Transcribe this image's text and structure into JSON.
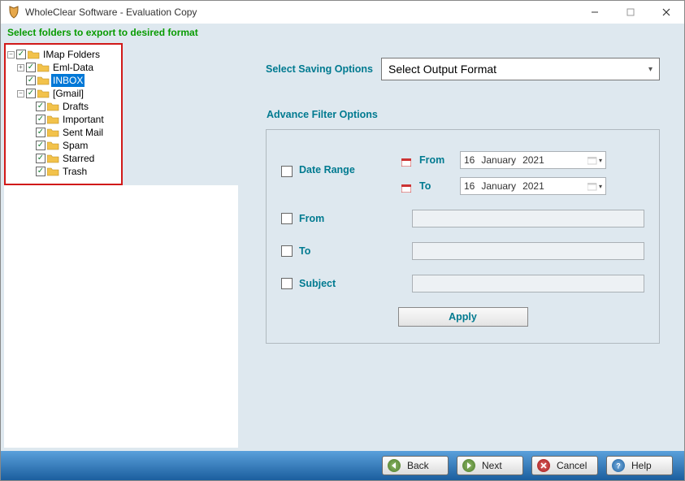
{
  "window": {
    "title": "WholeClear Software - Evaluation Copy"
  },
  "subtitle": "Select folders to export to desired format",
  "tree": {
    "root": "IMap Folders",
    "items": [
      "Eml-Data",
      "INBOX",
      "[Gmail]"
    ],
    "gmail_children": [
      "Drafts",
      "Important",
      "Sent Mail",
      "Spam",
      "Starred",
      "Trash"
    ]
  },
  "saving": {
    "label": "Select Saving Options",
    "placeholder": "Select Output Format"
  },
  "advance": {
    "legend": "Advance Filter Options",
    "date_range": "Date Range",
    "from_date_label": "From",
    "to_date_label": "To",
    "from_date": {
      "d": "16",
      "m": "January",
      "y": "2021"
    },
    "to_date": {
      "d": "16",
      "m": "January",
      "y": "2021"
    },
    "from": "From",
    "to": "To",
    "subject": "Subject",
    "apply": "Apply"
  },
  "buttons": {
    "back": "Back",
    "next": "Next",
    "cancel": "Cancel",
    "help": "Help"
  }
}
